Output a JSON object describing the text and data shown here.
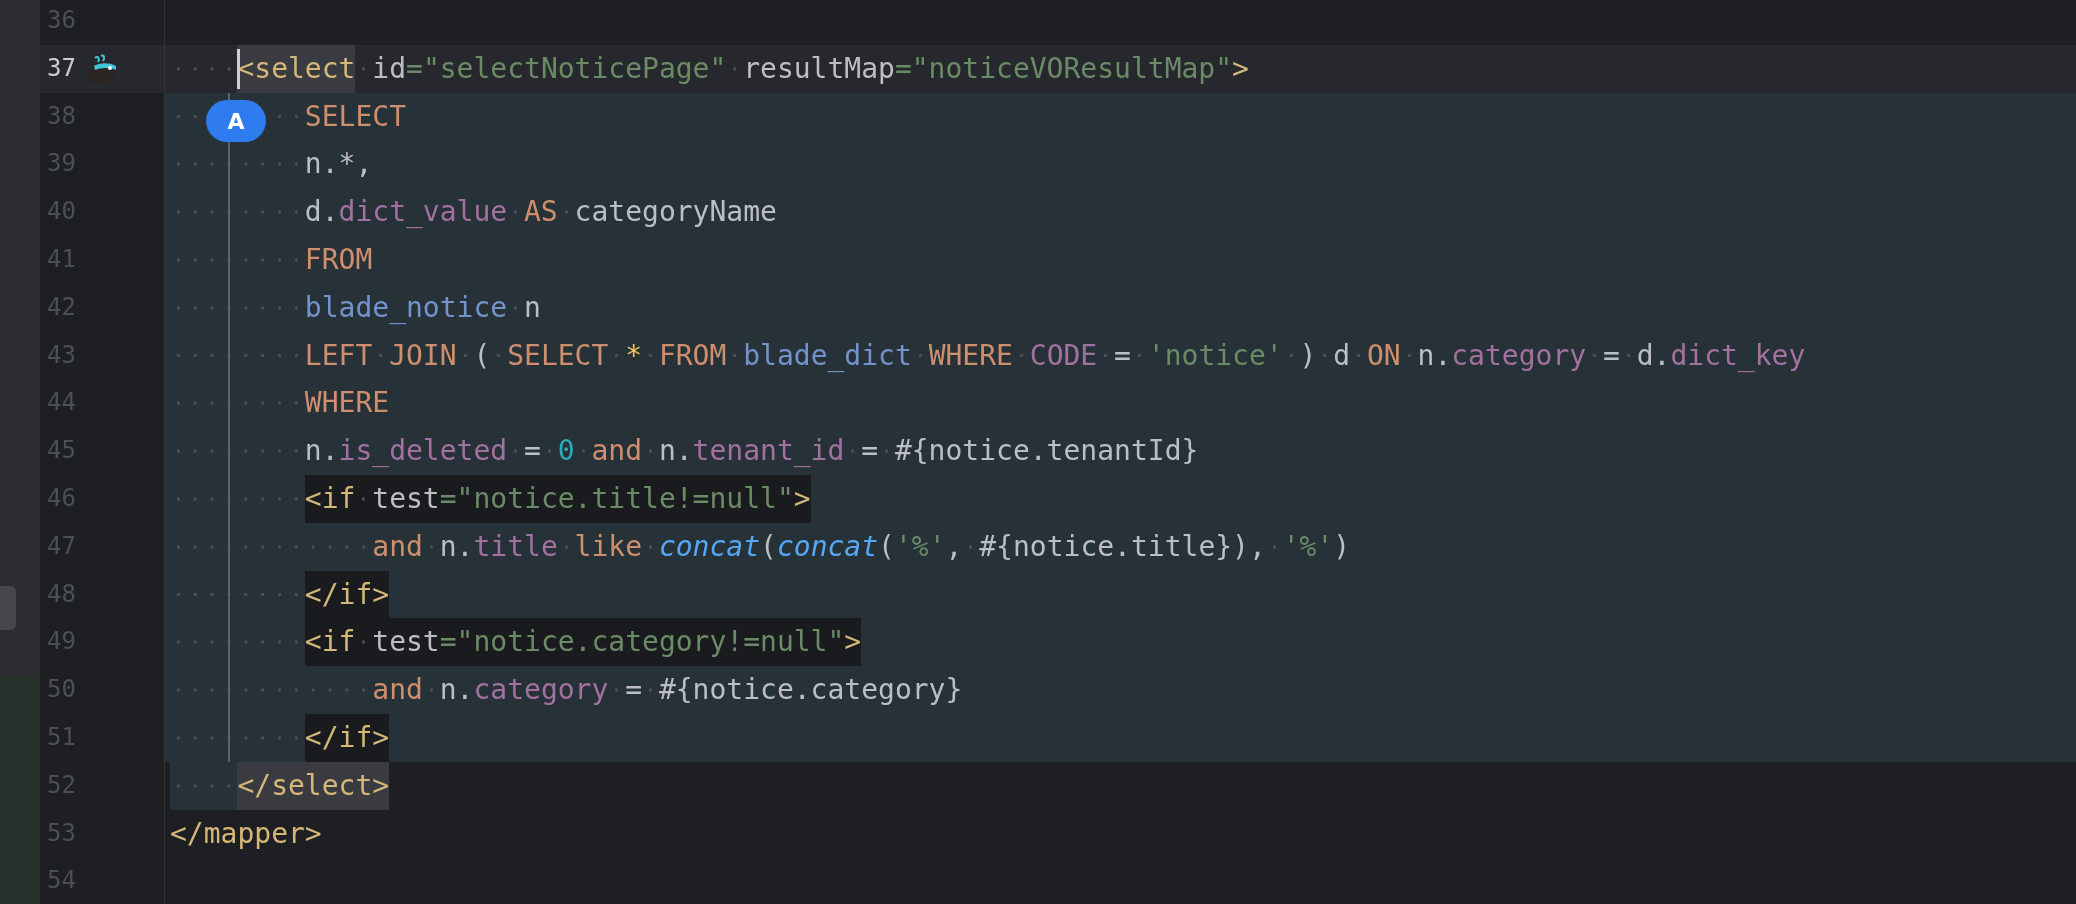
{
  "editor": {
    "badge": {
      "text": "A"
    },
    "lines": [
      {
        "number": "36",
        "current": false,
        "scope": false,
        "scope_edge": false,
        "guide": false,
        "caret": false,
        "gutter_icon": false
      },
      {
        "number": "37",
        "current": true,
        "scope": false,
        "scope_edge": false,
        "guide": false,
        "caret": true,
        "gutter_icon": true,
        "tokens": [
          {
            "kind": "boxed",
            "current_tag": true,
            "tokens": [
              {
                "kind": "tag",
                "text": "    <select"
              }
            ]
          },
          {
            "kind": "attr",
            "text": " id"
          },
          {
            "kind": "value",
            "text": "=\"selectNoticePage\""
          },
          {
            "kind": "attr",
            "text": " resultMap"
          },
          {
            "kind": "value",
            "text": "=\"noticeVOResultMap\""
          },
          {
            "kind": "tag",
            "text": ">"
          }
        ]
      },
      {
        "number": "38",
        "current": false,
        "scope": true,
        "scope_edge": false,
        "guide": true,
        "caret": false,
        "gutter_icon": false,
        "tokens": [
          {
            "kind": "keyword",
            "text": "        SELECT"
          }
        ]
      },
      {
        "number": "39",
        "current": false,
        "scope": true,
        "scope_edge": false,
        "guide": true,
        "caret": false,
        "gutter_icon": false,
        "tokens": [
          {
            "kind": "plain",
            "text": "        n.*,"
          }
        ]
      },
      {
        "number": "40",
        "current": false,
        "scope": true,
        "scope_edge": false,
        "guide": true,
        "caret": false,
        "gutter_icon": false,
        "tokens": [
          {
            "kind": "plain",
            "text": "        d."
          },
          {
            "kind": "column",
            "text": "dict_value"
          },
          {
            "kind": "keyword",
            "text": " AS"
          },
          {
            "kind": "plain",
            "text": " categoryName"
          }
        ]
      },
      {
        "number": "41",
        "current": false,
        "scope": true,
        "scope_edge": false,
        "guide": true,
        "caret": false,
        "gutter_icon": false,
        "tokens": [
          {
            "kind": "keyword",
            "text": "        FROM"
          }
        ]
      },
      {
        "number": "42",
        "current": false,
        "scope": true,
        "scope_edge": false,
        "guide": true,
        "caret": false,
        "gutter_icon": false,
        "tokens": [
          {
            "kind": "table",
            "text": "        blade_notice"
          },
          {
            "kind": "plain",
            "text": " n"
          }
        ]
      },
      {
        "number": "43",
        "current": false,
        "scope": true,
        "scope_edge": false,
        "guide": true,
        "caret": false,
        "gutter_icon": false,
        "tokens": [
          {
            "kind": "keyword",
            "text": "        LEFT JOIN"
          },
          {
            "kind": "plain",
            "text": " ( "
          },
          {
            "kind": "keyword",
            "text": "SELECT"
          },
          {
            "kind": "star",
            "text": " * "
          },
          {
            "kind": "keyword",
            "text": "FROM"
          },
          {
            "kind": "table",
            "text": " blade_dict"
          },
          {
            "kind": "keyword",
            "text": " WHERE"
          },
          {
            "kind": "column",
            "text": " CODE"
          },
          {
            "kind": "plain",
            "text": " = "
          },
          {
            "kind": "string",
            "text": "'notice'"
          },
          {
            "kind": "plain",
            "text": " ) d "
          },
          {
            "kind": "keyword",
            "text": "ON"
          },
          {
            "kind": "plain",
            "text": " n."
          },
          {
            "kind": "column",
            "text": "category"
          },
          {
            "kind": "plain",
            "text": " = d."
          },
          {
            "kind": "column",
            "text": "dict_key"
          }
        ]
      },
      {
        "number": "44",
        "current": false,
        "scope": true,
        "scope_edge": false,
        "guide": true,
        "caret": false,
        "gutter_icon": false,
        "tokens": [
          {
            "kind": "keyword",
            "text": "        WHERE"
          }
        ]
      },
      {
        "number": "45",
        "current": false,
        "scope": true,
        "scope_edge": false,
        "guide": true,
        "caret": false,
        "gutter_icon": false,
        "tokens": [
          {
            "kind": "plain",
            "text": "        n."
          },
          {
            "kind": "column",
            "text": "is_deleted"
          },
          {
            "kind": "plain",
            "text": " = "
          },
          {
            "kind": "number",
            "text": "0"
          },
          {
            "kind": "keyword",
            "text": " and"
          },
          {
            "kind": "plain",
            "text": " n."
          },
          {
            "kind": "column",
            "text": "tenant_id"
          },
          {
            "kind": "plain",
            "text": " = #{notice.tenantId}"
          }
        ]
      },
      {
        "number": "46",
        "current": false,
        "scope": true,
        "scope_edge": false,
        "guide": true,
        "caret": false,
        "gutter_icon": false,
        "tokens": [
          {
            "kind": "boxed",
            "current_tag": false,
            "tokens": [
              {
                "kind": "tag",
                "text": "        <if"
              },
              {
                "kind": "attr",
                "text": " test"
              },
              {
                "kind": "value",
                "text": "=\"notice.title!=null\""
              },
              {
                "kind": "tag",
                "text": ">"
              }
            ]
          }
        ]
      },
      {
        "number": "47",
        "current": false,
        "scope": true,
        "scope_edge": false,
        "guide": true,
        "caret": false,
        "gutter_icon": false,
        "tokens": [
          {
            "kind": "keyword",
            "text": "            and"
          },
          {
            "kind": "plain",
            "text": " n."
          },
          {
            "kind": "column",
            "text": "title"
          },
          {
            "kind": "keyword",
            "text": " like "
          },
          {
            "kind": "func",
            "text": "concat"
          },
          {
            "kind": "plain",
            "text": "("
          },
          {
            "kind": "func",
            "text": "concat"
          },
          {
            "kind": "plain",
            "text": "("
          },
          {
            "kind": "string",
            "text": "'%'"
          },
          {
            "kind": "plain",
            "text": ", #{notice.title}), "
          },
          {
            "kind": "string",
            "text": "'%'"
          },
          {
            "kind": "plain",
            "text": ")"
          }
        ]
      },
      {
        "number": "48",
        "current": false,
        "scope": true,
        "scope_edge": false,
        "guide": true,
        "caret": false,
        "gutter_icon": false,
        "tokens": [
          {
            "kind": "boxed",
            "current_tag": false,
            "tokens": [
              {
                "kind": "tag",
                "text": "        </if>"
              }
            ]
          }
        ]
      },
      {
        "number": "49",
        "current": false,
        "scope": true,
        "scope_edge": false,
        "guide": true,
        "caret": false,
        "gutter_icon": false,
        "tokens": [
          {
            "kind": "boxed",
            "current_tag": false,
            "tokens": [
              {
                "kind": "tag",
                "text": "        <if"
              },
              {
                "kind": "attr",
                "text": " test"
              },
              {
                "kind": "value",
                "text": "=\"notice.category!=null\""
              },
              {
                "kind": "tag",
                "text": ">"
              }
            ]
          }
        ]
      },
      {
        "number": "50",
        "current": false,
        "scope": true,
        "scope_edge": false,
        "guide": true,
        "caret": false,
        "gutter_icon": false,
        "tokens": [
          {
            "kind": "keyword",
            "text": "            and"
          },
          {
            "kind": "plain",
            "text": " n."
          },
          {
            "kind": "column",
            "text": "category"
          },
          {
            "kind": "plain",
            "text": " = #{notice.category}"
          }
        ]
      },
      {
        "number": "51",
        "current": false,
        "scope": true,
        "scope_edge": false,
        "guide": true,
        "caret": false,
        "gutter_icon": false,
        "tokens": [
          {
            "kind": "boxed",
            "current_tag": false,
            "tokens": [
              {
                "kind": "tag",
                "text": "        </if>"
              }
            ]
          }
        ]
      },
      {
        "number": "52",
        "current": false,
        "scope": false,
        "scope_edge": true,
        "guide": false,
        "caret": false,
        "gutter_icon": false,
        "tokens": [
          {
            "kind": "boxed",
            "current_tag": true,
            "tokens": [
              {
                "kind": "tag",
                "text": "    </select>"
              }
            ]
          }
        ]
      },
      {
        "number": "53",
        "current": false,
        "scope": false,
        "scope_edge": false,
        "guide": false,
        "caret": false,
        "gutter_icon": false,
        "tokens": [
          {
            "kind": "tag",
            "text": "</mapper>"
          }
        ]
      },
      {
        "number": "54",
        "current": false,
        "scope": false,
        "scope_edge": false,
        "guide": false,
        "caret": false,
        "gutter_icon": false
      }
    ]
  }
}
